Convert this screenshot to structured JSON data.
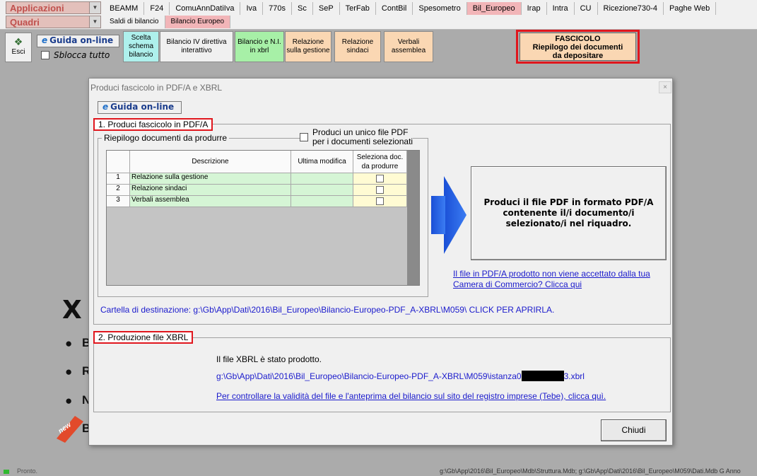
{
  "combos": {
    "applicazioni": "Applicazioni",
    "quadri": "Quadri",
    "arrow": "▼"
  },
  "tabs_top": [
    "BEAMM",
    "F24",
    "ComuAnnDatiIva",
    "Iva",
    "770s",
    "Sc",
    "SeP",
    "TerFab",
    "ContBil",
    "Spesometro",
    "Bil_Europeo",
    "Irap",
    "Intra",
    "CU",
    "Ricezione730-4",
    "Paghe Web"
  ],
  "tabs_sub": [
    "Saldi di bilancio",
    "Bilancio Europeo"
  ],
  "ribbon": {
    "esci": "Esci",
    "guida": "Guida on-line",
    "sblocca": "Sblocca tutto",
    "scelta_schema": "Scelta schema bilancio",
    "bilancio_iv": "Bilancio IV direttiva interattivo",
    "bilancio_ni": "Bilancio e N.I. in xbrl",
    "relazione_gestione": "Relazione sulla gestione",
    "relazione_sindaci": "Relazione sindaci",
    "verbali": "Verbali assemblea",
    "fascicolo_line1": "FASCICOLO",
    "fascicolo_line2": "Riepilogo dei documenti",
    "fascicolo_line3": "da depositare"
  },
  "background": {
    "bullets": [
      "B",
      "R",
      "N",
      "B"
    ],
    "logo_text": "X",
    "new_badge": "new"
  },
  "dialog": {
    "title": "Produci fascicolo in PDF/A e XBRL",
    "close": "×",
    "guida": "Guida on-line",
    "section1_label": "1. Produci fascicolo in PDF/A",
    "riepilogo_label": "Riepilogo documenti da produrre",
    "unico_line1": "Produci un unico file PDF",
    "unico_line2": "per i documenti selezionati",
    "grid": {
      "col_descrizione": "Descrizione",
      "col_ultima": "Ultima modifica",
      "col_seleziona_1": "Seleziona doc.",
      "col_seleziona_2": "da produrre",
      "rows": [
        {
          "num": "1",
          "descrizione": "Relazione sulla gestione",
          "ultima": ""
        },
        {
          "num": "2",
          "descrizione": "Relazione sindaci",
          "ultima": ""
        },
        {
          "num": "3",
          "descrizione": "Verbali assemblea",
          "ultima": ""
        }
      ]
    },
    "produci_line1": "Produci il file PDF in formato PDF/A",
    "produci_line2": "contenente il/i documento/i",
    "produci_line3": "selezionato/i nel riquadro.",
    "camera_line1": "Il file in PDF/A prodotto non viene accettato dalla tua",
    "camera_line2": "Camera di Commercio? Clicca qui",
    "cartella": "Cartella di destinazione: g:\\Gb\\App\\Dati\\2016\\Bil_Europeo\\Bilancio-Europeo-PDF_A-XBRL\\M059\\ CLICK PER APRIRLA.",
    "section2_label": "2. Produzione file XBRL",
    "xbrl_msg": "Il file XBRL è stato prodotto.",
    "xbrl_path_prefix": "g:\\Gb\\App\\Dati\\2016\\Bil_Europeo\\Bilancio-Europeo-PDF_A-XBRL\\M059\\istanza0",
    "xbrl_path_suffix": "3.xbrl",
    "tebe_link": "Per controllare la validità del file e l'anteprima del bilancio sul sito del registro imprese (Tebe), clicca quì.",
    "chiudi": "Chiudi"
  },
  "statusbar": {
    "left": "Pronto.",
    "right": "g:\\Gb\\App\\2016\\Bil_Europeo\\Mdb\\Struttura.Mdb; g:\\Gb\\App\\Dati\\2016\\Bil_Europeo\\M059\\Dati.Mdb G  Anno"
  },
  "colors": {
    "active_tab": "#f2b5b8",
    "highlight_border": "#e0161d",
    "grid_row": "#d5f5d5",
    "arrow_blue": "#2f66e8",
    "link": "#1a1acc"
  }
}
